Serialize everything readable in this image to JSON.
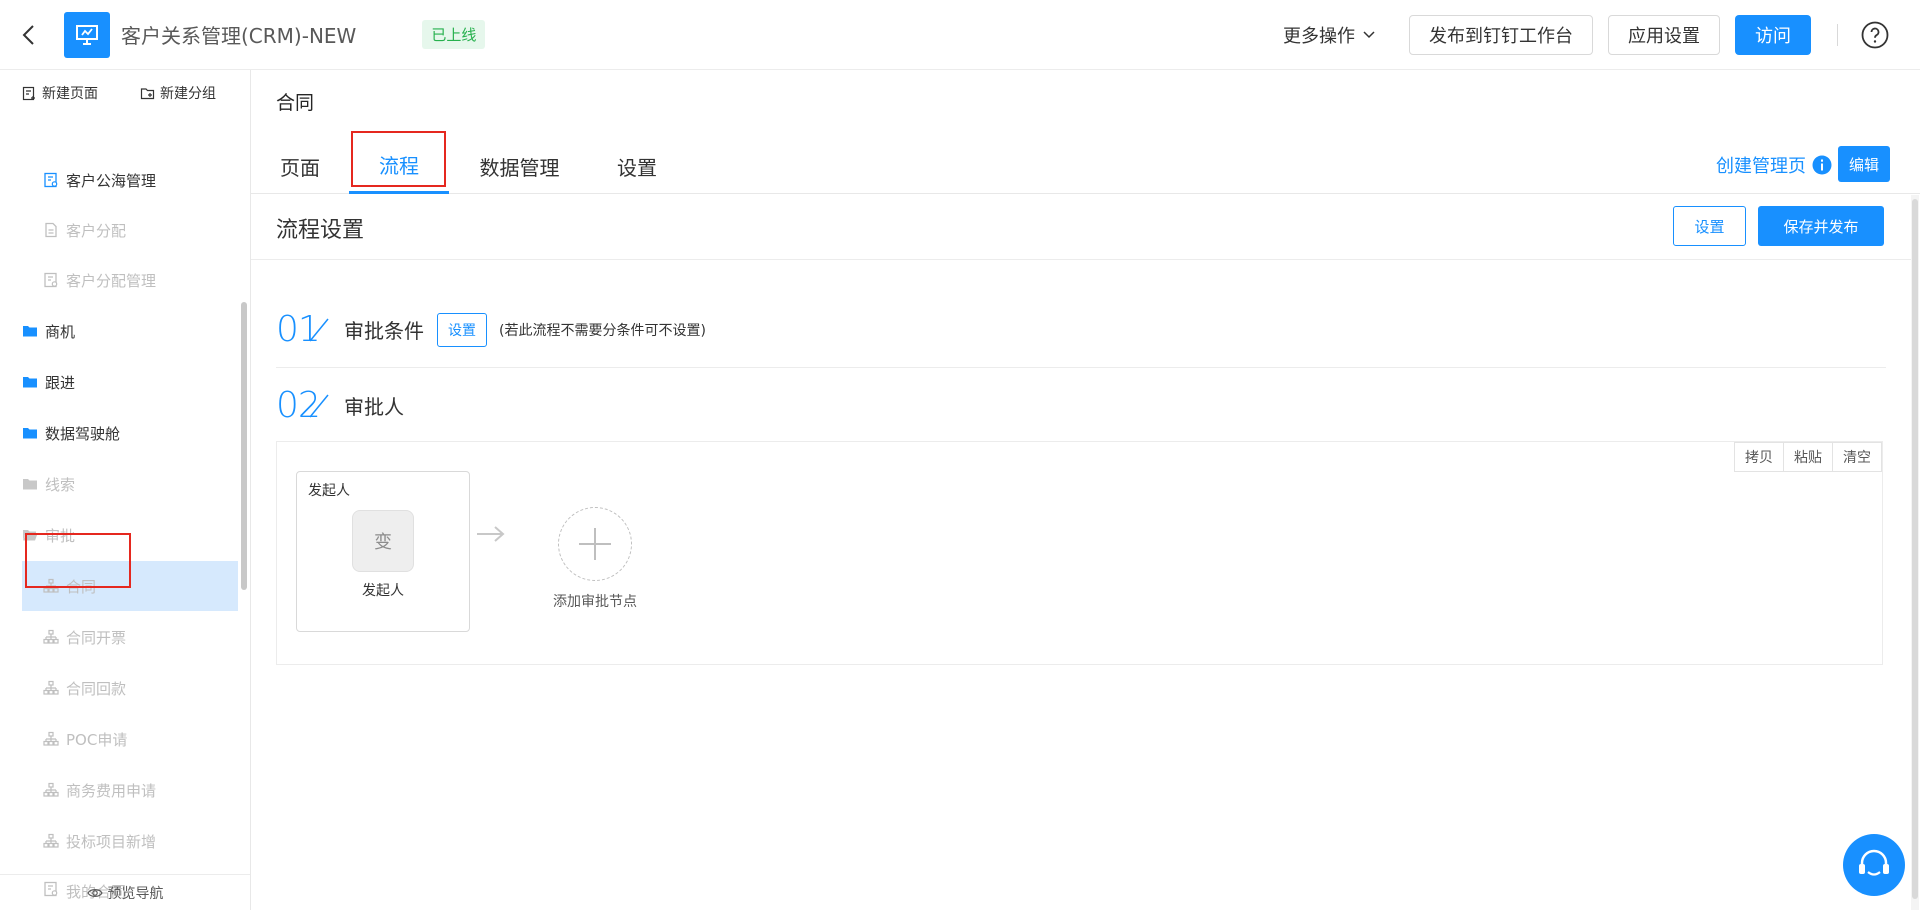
{
  "header": {
    "app_title": "客户关系管理(CRM)-NEW",
    "status_badge": "已上线",
    "more_ops": "更多操作",
    "publish_dingtalk": "发布到钉钉工作台",
    "app_settings": "应用设置",
    "visit": "访问"
  },
  "sidebar": {
    "new_page": "新建页面",
    "new_group": "新建分组",
    "items": [
      {
        "label": "客户公海管理",
        "icon": "form-icon",
        "state": "dark"
      },
      {
        "label": "客户分配",
        "icon": "doc-icon",
        "state": "dim"
      },
      {
        "label": "客户分配管理",
        "icon": "form-icon",
        "state": "dim"
      },
      {
        "label": "商机",
        "icon": "folder-icon",
        "state": "folder"
      },
      {
        "label": "跟进",
        "icon": "folder-icon",
        "state": "folder"
      },
      {
        "label": "数据驾驶舱",
        "icon": "folder-icon",
        "state": "folder"
      },
      {
        "label": "线索",
        "icon": "folder-icon",
        "state": "folder-dim"
      },
      {
        "label": "审批",
        "icon": "folder-open-icon",
        "state": "folder-dim"
      },
      {
        "label": "合同",
        "icon": "flow-icon",
        "state": "selected"
      },
      {
        "label": "合同开票",
        "icon": "flow-icon",
        "state": "dim"
      },
      {
        "label": "合同回款",
        "icon": "flow-icon",
        "state": "dim"
      },
      {
        "label": "POC申请",
        "icon": "flow-icon",
        "state": "dim"
      },
      {
        "label": "商务费用申请",
        "icon": "flow-icon",
        "state": "dim"
      },
      {
        "label": "投标项目新增",
        "icon": "flow-icon",
        "state": "dim"
      },
      {
        "label": "我的合同",
        "icon": "form-icon",
        "state": "dim"
      }
    ],
    "preview_nav": "预览导航"
  },
  "main": {
    "breadcrumb": "合同",
    "tabs": [
      "页面",
      "流程",
      "数据管理",
      "设置"
    ],
    "active_tab": "流程",
    "create_mgmt": "创建管理页",
    "edit": "编辑",
    "flow_title": "流程设置",
    "settings_btn": "设置",
    "save_publish": "保存并发布",
    "step1": {
      "num": "01",
      "label": "审批条件",
      "btn": "设置",
      "hint": "(若此流程不需要分条件可不设置)"
    },
    "step2": {
      "num": "02",
      "label": "审批人"
    },
    "canvas_tools": [
      "拷贝",
      "粘贴",
      "清空"
    ],
    "initiator_node": {
      "label": "发起人",
      "avatar": "变",
      "name": "发起人"
    },
    "add_node": "添加审批节点"
  },
  "colors": {
    "primary": "#1890ff",
    "success_bg": "#e6f7ec",
    "success_text": "#27b14e",
    "highlight_box": "#e5281f"
  }
}
